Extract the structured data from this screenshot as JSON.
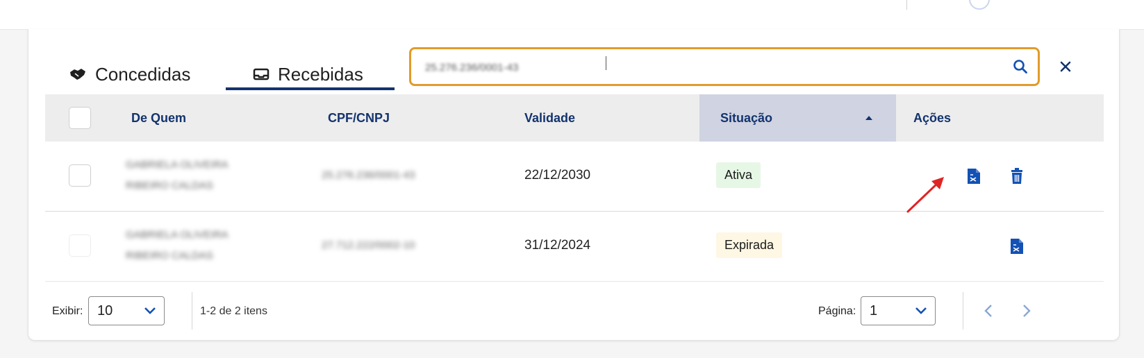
{
  "tabs": {
    "concedidas": {
      "label": "Concedidas",
      "icon": "handshake-icon"
    },
    "recebidas": {
      "label": "Recebidas",
      "icon": "inbox-icon",
      "active": true
    }
  },
  "search": {
    "value": "25.276.236/0001-43",
    "icon": "search-icon",
    "clear_icon": "close-icon"
  },
  "table": {
    "headers": {
      "de_quem": "De Quem",
      "cpf_cnpj": "CPF/CNPJ",
      "validade": "Validade",
      "situacao": "Situação",
      "acoes": "Ações"
    },
    "sorted_column": "situacao",
    "rows": [
      {
        "de_quem_line1": "GABRIELA OLIVEIRA",
        "de_quem_line2": "RIBEIRO CALDAS",
        "cpf_cnpj": "25.276.236/0001-43",
        "validade": "22/12/2030",
        "situacao": "Ativa"
      },
      {
        "de_quem_line1": "GABRIELA OLIVEIRA",
        "de_quem_line2": "RIBEIRO CALDAS",
        "cpf_cnpj": "27.712.222/0002-10",
        "validade": "31/12/2024",
        "situacao": "Expirada"
      }
    ]
  },
  "footer": {
    "exibir_label": "Exibir:",
    "page_size": "10",
    "range_text": "1-2 de 2 itens",
    "pagina_label": "Página:",
    "page": "1"
  },
  "colors": {
    "brand_navy": "#13336e",
    "icon_blue": "#1351b4",
    "search_border": "#e29b29",
    "annotation_red": "#e02424"
  }
}
